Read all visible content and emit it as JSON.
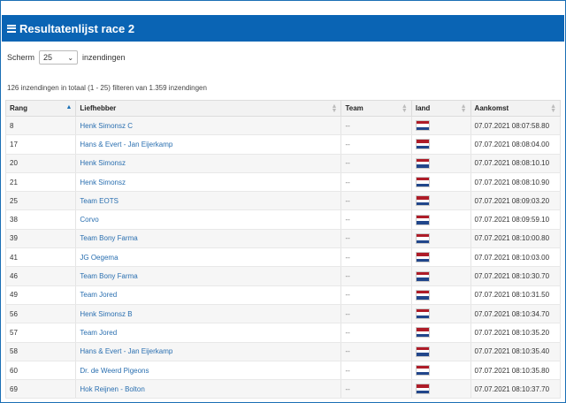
{
  "header": {
    "title": "Resultatenlijst race 2",
    "icon": "list-icon"
  },
  "controls": {
    "prefix": "Scherm",
    "page_size": "25",
    "suffix": "inzendingen"
  },
  "info": "126 inzendingen in totaal (1 - 25) filteren van 1.359 inzendingen",
  "columns": [
    "Rang",
    "Liefhebber",
    "Team",
    "land",
    "Aankomst"
  ],
  "flag_colors": {
    "red": "#ae1c28",
    "white": "#ffffff",
    "blue": "#21468b"
  },
  "rows": [
    {
      "rang": "8",
      "liefhebber": "Henk Simonsz C",
      "team": "--",
      "land": "NL",
      "aankomst": "07.07.2021 08:07:58.80"
    },
    {
      "rang": "17",
      "liefhebber": "Hans & Evert - Jan Eijerkamp",
      "team": "--",
      "land": "NL",
      "aankomst": "07.07.2021 08:08:04.00"
    },
    {
      "rang": "20",
      "liefhebber": "Henk Simonsz",
      "team": "--",
      "land": "NL",
      "aankomst": "07.07.2021 08:08:10.10"
    },
    {
      "rang": "21",
      "liefhebber": "Henk Simonsz",
      "team": "--",
      "land": "NL",
      "aankomst": "07.07.2021 08:08:10.90"
    },
    {
      "rang": "25",
      "liefhebber": "Team EOTS",
      "team": "--",
      "land": "NL",
      "aankomst": "07.07.2021 08:09:03.20"
    },
    {
      "rang": "38",
      "liefhebber": "Corvo",
      "team": "--",
      "land": "NL",
      "aankomst": "07.07.2021 08:09:59.10"
    },
    {
      "rang": "39",
      "liefhebber": "Team Bony Farma",
      "team": "--",
      "land": "NL",
      "aankomst": "07.07.2021 08:10:00.80"
    },
    {
      "rang": "41",
      "liefhebber": "JG Oegema",
      "team": "--",
      "land": "NL",
      "aankomst": "07.07.2021 08:10:03.00"
    },
    {
      "rang": "46",
      "liefhebber": "Team Bony Farma",
      "team": "--",
      "land": "NL",
      "aankomst": "07.07.2021 08:10:30.70"
    },
    {
      "rang": "49",
      "liefhebber": "Team Jored",
      "team": "--",
      "land": "NL",
      "aankomst": "07.07.2021 08:10:31.50"
    },
    {
      "rang": "56",
      "liefhebber": "Henk Simonsz B",
      "team": "--",
      "land": "NL",
      "aankomst": "07.07.2021 08:10:34.70"
    },
    {
      "rang": "57",
      "liefhebber": "Team Jored",
      "team": "--",
      "land": "NL",
      "aankomst": "07.07.2021 08:10:35.20"
    },
    {
      "rang": "58",
      "liefhebber": "Hans & Evert - Jan Eijerkamp",
      "team": "--",
      "land": "NL",
      "aankomst": "07.07.2021 08:10:35.40"
    },
    {
      "rang": "60",
      "liefhebber": "Dr. de Weerd Pigeons",
      "team": "--",
      "land": "NL",
      "aankomst": "07.07.2021 08:10:35.80"
    },
    {
      "rang": "69",
      "liefhebber": "Hok Reijnen - Bolton",
      "team": "--",
      "land": "NL",
      "aankomst": "07.07.2021 08:10:37.70"
    }
  ]
}
